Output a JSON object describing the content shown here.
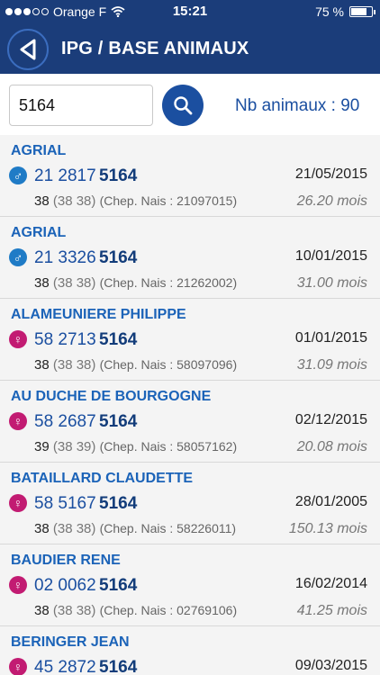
{
  "status_bar": {
    "carrier": "Orange F",
    "time": "15:21",
    "battery": "75 %"
  },
  "header": {
    "title": "IPG / BASE ANIMAUX"
  },
  "search": {
    "value": "5164",
    "count_label": "Nb animaux : 90"
  },
  "animals": [
    {
      "owner": "AGRIAL",
      "sex": "male",
      "number": "21 2817",
      "code": "5164",
      "date": "21/05/2015",
      "dept": "38",
      "dept_paren": "(38 38)",
      "chep": "(Chep. Nais : 21097015)",
      "age": "26.20 mois"
    },
    {
      "owner": "AGRIAL",
      "sex": "male",
      "number": "21 3326",
      "code": "5164",
      "date": "10/01/2015",
      "dept": "38",
      "dept_paren": "(38 38)",
      "chep": "(Chep. Nais : 21262002)",
      "age": "31.00 mois"
    },
    {
      "owner": "ALAMEUNIERE PHILIPPE",
      "sex": "female",
      "number": "58 2713",
      "code": "5164",
      "date": "01/01/2015",
      "dept": "38",
      "dept_paren": "(38 38)",
      "chep": "(Chep. Nais : 58097096)",
      "age": "31.09 mois"
    },
    {
      "owner": "AU DUCHE DE BOURGOGNE",
      "sex": "female",
      "number": "58 2687",
      "code": "5164",
      "date": "02/12/2015",
      "dept": "39",
      "dept_paren": "(38 39)",
      "chep": "(Chep. Nais : 58057162)",
      "age": "20.08 mois"
    },
    {
      "owner": "BATAILLARD CLAUDETTE",
      "sex": "female",
      "number": "58 5167",
      "code": "5164",
      "date": "28/01/2005",
      "dept": "38",
      "dept_paren": "(38 38)",
      "chep": "(Chep. Nais : 58226011)",
      "age": "150.13 mois"
    },
    {
      "owner": "BAUDIER RENE",
      "sex": "female",
      "number": "02 0062",
      "code": "5164",
      "date": "16/02/2014",
      "dept": "38",
      "dept_paren": "(38 38)",
      "chep": "(Chep. Nais : 02769106)",
      "age": "41.25 mois"
    },
    {
      "owner": "BERINGER JEAN",
      "sex": "female",
      "number": "45 2872",
      "code": "5164",
      "date": "09/03/2015",
      "dept": "",
      "dept_paren": "",
      "chep": "",
      "age": ""
    }
  ],
  "icons": {
    "back": "back-arrow-icon",
    "search": "search-icon",
    "male": "male-symbol-icon",
    "female": "female-symbol-icon",
    "wifi": "wifi-icon",
    "battery": "battery-icon"
  },
  "colors": {
    "header_bg": "#1b3d7a",
    "accent": "#1b4fa0",
    "owner_text": "#1b63b8",
    "male": "#1f7bc6",
    "female": "#c21b72"
  }
}
